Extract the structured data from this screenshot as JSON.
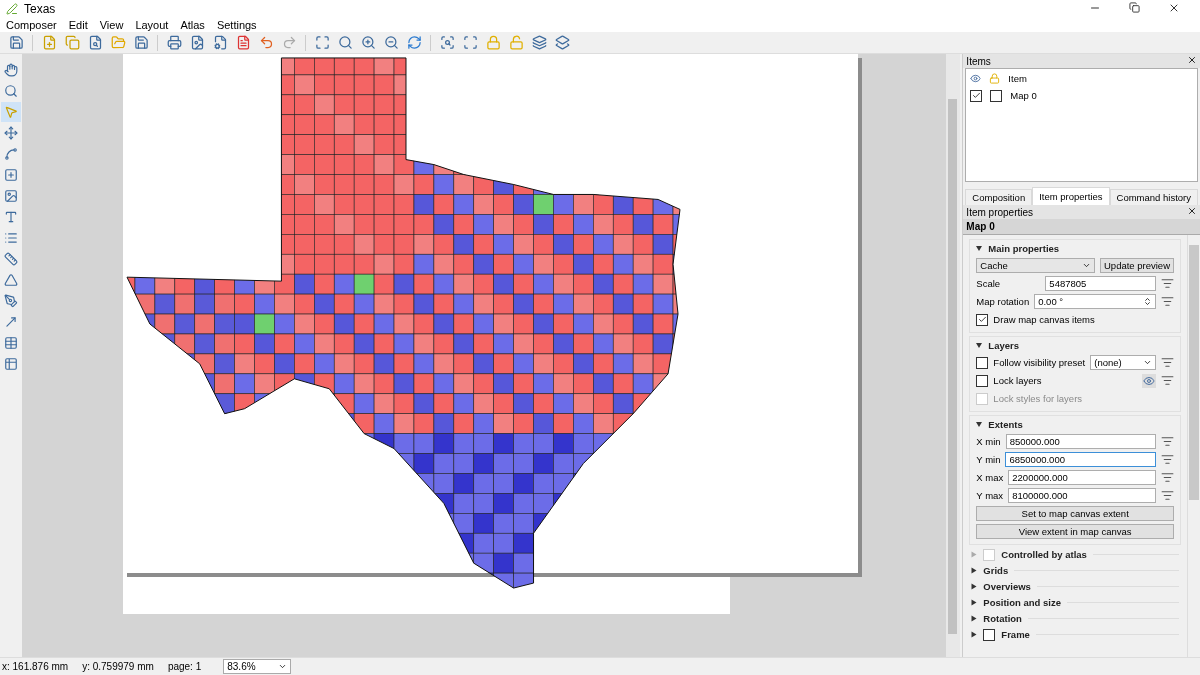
{
  "window": {
    "title": "Texas"
  },
  "menu": [
    "Composer",
    "Edit",
    "View",
    "Layout",
    "Atlas",
    "Settings"
  ],
  "items_panel": {
    "title": "Items",
    "header_label": "Item",
    "rows": [
      {
        "label": "Map 0",
        "visible": true,
        "locked": false
      }
    ]
  },
  "tabs": [
    {
      "label": "Composition",
      "selected": false
    },
    {
      "label": "Item properties",
      "selected": true
    },
    {
      "label": "Command history",
      "selected": false
    }
  ],
  "properties_panel": {
    "title": "Item properties",
    "item_name": "Map 0",
    "main": {
      "title": "Main properties",
      "expanded": true,
      "mode": "Cache",
      "update_button": "Update preview",
      "scale_label": "Scale",
      "scale_value": "5487805",
      "rotation_label": "Map rotation",
      "rotation_value": "0.00 °",
      "draw_items": {
        "label": "Draw map canvas items",
        "checked": true
      }
    },
    "layers": {
      "title": "Layers",
      "expanded": true,
      "follow_preset": {
        "label": "Follow visibility preset",
        "checked": false,
        "value": "(none)"
      },
      "lock_layers": {
        "label": "Lock layers",
        "checked": false
      },
      "lock_styles": {
        "label": "Lock styles for layers",
        "checked": false,
        "disabled": true
      }
    },
    "extents": {
      "title": "Extents",
      "expanded": true,
      "fields": [
        {
          "label": "X min",
          "value": "850000.000",
          "focused": false
        },
        {
          "label": "Y min",
          "value": "6850000.000",
          "focused": true
        },
        {
          "label": "X max",
          "value": "2200000.000",
          "focused": false
        },
        {
          "label": "Y max",
          "value": "8100000.000",
          "focused": false
        }
      ],
      "buttons": [
        "Set to map canvas extent",
        "View extent in map canvas"
      ]
    },
    "collapsed_sections": [
      {
        "title": "Controlled by atlas",
        "kind": "checkbox",
        "checked": false,
        "expanded": false,
        "disabled": true
      },
      {
        "title": "Grids",
        "kind": "plain",
        "expanded": false
      },
      {
        "title": "Overviews",
        "kind": "plain",
        "expanded": false
      },
      {
        "title": "Position and size",
        "kind": "plain",
        "expanded": false
      },
      {
        "title": "Rotation",
        "kind": "plain",
        "expanded": false
      },
      {
        "title": "Frame",
        "kind": "checkbox",
        "checked": false,
        "expanded": false,
        "disabled": false
      }
    ]
  },
  "status_bar": {
    "x": "x: 161.876 mm",
    "y": "y: 0.759979 mm",
    "page": "page: 1",
    "zoom": "83.6%"
  }
}
